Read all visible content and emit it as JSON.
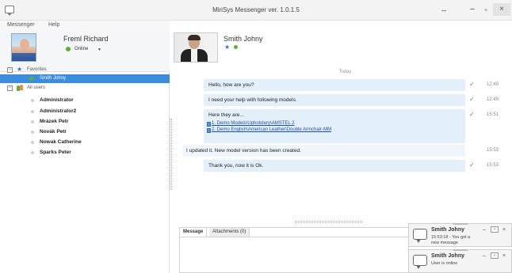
{
  "window": {
    "title": "MiriSys Messenger ver. 1.0.1.5",
    "controls": {
      "restore": "↔",
      "minimize": "–",
      "maximize": "▫",
      "close": "×"
    }
  },
  "menu": {
    "items": [
      "Messenger",
      "Help"
    ]
  },
  "profile": {
    "name": "Freml Richard",
    "status": "Online"
  },
  "tree": {
    "favorites_label": "Favorites",
    "favorites": [
      "Smith Johny"
    ],
    "all_users_label": "All users",
    "users": [
      "Administrator",
      "Administrator2",
      "Mrázek Petr",
      "Novák Petr",
      "Nowak Catherine",
      "Sparks Peter"
    ]
  },
  "contact": {
    "name": "Smith Johny"
  },
  "chat": {
    "day_label": "Today",
    "messages": [
      {
        "text": "Hello, how are you?",
        "time": "12:49"
      },
      {
        "text": "I need your help with following models.",
        "time": "12:49"
      },
      {
        "text": "Here they are...",
        "links": [
          "1. Demo Models\\Upholstery\\AMSTEL 2",
          "2. Demo English\\American Leather\\Double Armchair-MM"
        ],
        "time": "15:51"
      },
      {
        "text": "I updated it. New model version has been created.",
        "time": "15:53"
      },
      {
        "text": "Thank you, now it is Ok.",
        "time": "15:53"
      }
    ]
  },
  "compose": {
    "tabs": [
      "Message",
      "Attachments (0)"
    ]
  },
  "notifications": [
    {
      "name": "Smith Johny",
      "text": "15:53:18 - You got a new message"
    },
    {
      "name": "Smith Johny",
      "text": "User is online"
    }
  ],
  "colors": {
    "accent": "#3a8ddc",
    "bubble": "#e3f0fa",
    "status_online": "#58b32e",
    "link": "#1f4fa3"
  },
  "icons": [
    "app-icon",
    "star-icon",
    "users-icon",
    "check-icon",
    "file-icon",
    "chat-bubble-icon",
    "pin-icon",
    "close-icon"
  ]
}
